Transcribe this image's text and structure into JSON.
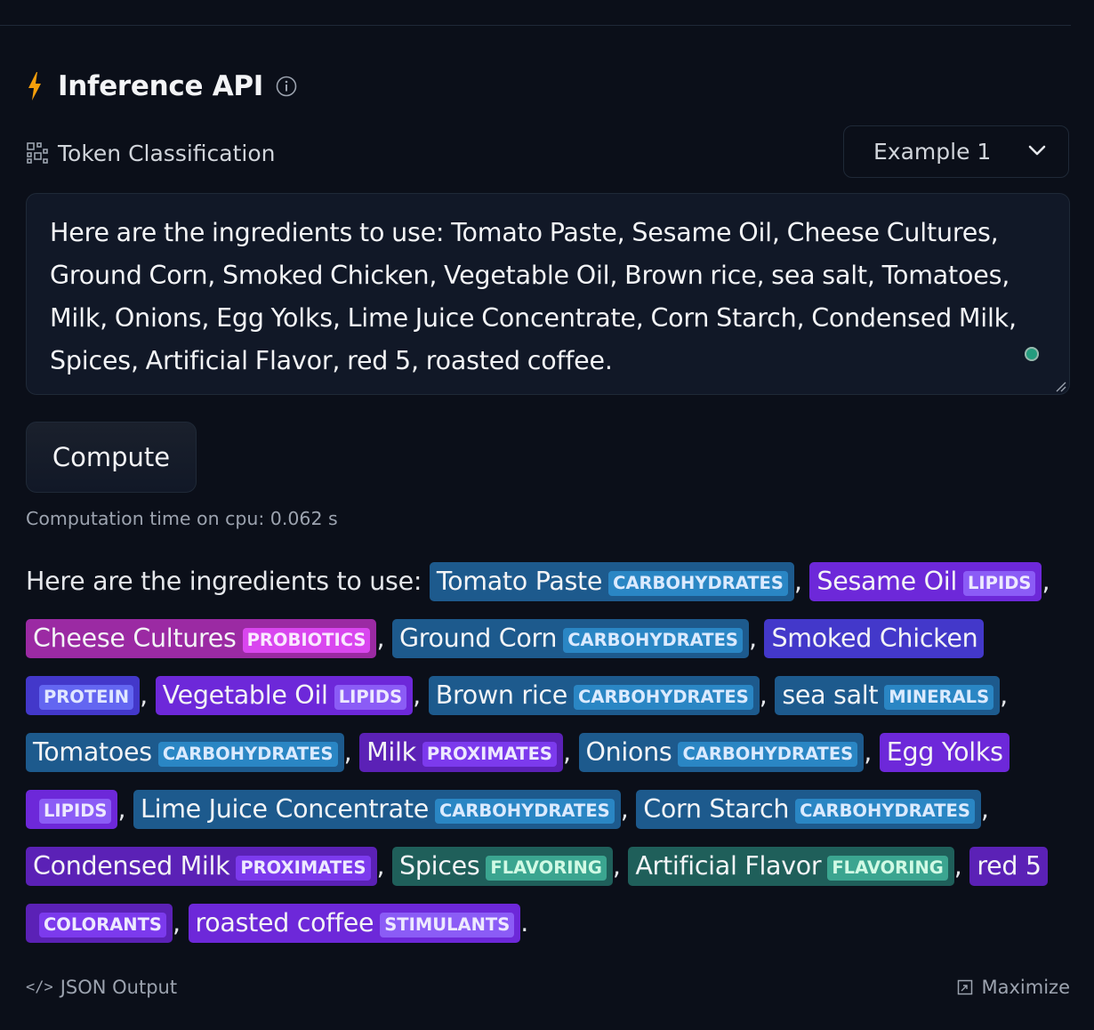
{
  "header": {
    "title": "Inference API"
  },
  "task": {
    "label": "Token Classification"
  },
  "example_select": {
    "selected": "Example 1"
  },
  "input": {
    "text": "Here are the ingredients to use: Tomato Paste, Sesame Oil, Cheese Cultures,  Ground Corn, Smoked Chicken, Vegetable Oil, Brown rice, sea salt, Tomatoes, Milk, Onions, Egg Yolks, Lime Juice Concentrate, Corn Starch, Condensed Milk, Spices, Artificial Flavor, red 5, roasted coffee."
  },
  "compute_button": {
    "label": "Compute"
  },
  "computation_time": "Computation time on cpu: 0.062 s",
  "output": {
    "prefix": "Here are the ingredients to use: ",
    "entities": [
      {
        "text": "Tomato Paste",
        "label": "CARBOHYDRATES",
        "sep": ", "
      },
      {
        "text": "Sesame Oil",
        "label": "LIPIDS",
        "sep": ", "
      },
      {
        "text": "Cheese Cultures",
        "label": "PROBIOTICS",
        "sep": ", "
      },
      {
        "text": "Ground Corn",
        "label": "CARBOHYDRATES",
        "sep": ", "
      },
      {
        "text": "Smoked Chicken",
        "label": "PROTEIN",
        "sep": ", "
      },
      {
        "text": "Vegetable Oil",
        "label": "LIPIDS",
        "sep": ", "
      },
      {
        "text": "Brown rice",
        "label": "CARBOHYDRATES",
        "sep": ", "
      },
      {
        "text": "sea salt",
        "label": "MINERALS",
        "sep": ", "
      },
      {
        "text": "Tomatoes",
        "label": "CARBOHYDRATES",
        "sep": ", "
      },
      {
        "text": "Milk",
        "label": "PROXIMATES",
        "sep": ", "
      },
      {
        "text": "Onions",
        "label": "CARBOHYDRATES",
        "sep": ", "
      },
      {
        "text": "Egg Yolks",
        "label": "LIPIDS",
        "sep": ", "
      },
      {
        "text": "Lime Juice Concentrate",
        "label": "CARBOHYDRATES",
        "sep": ", "
      },
      {
        "text": "Corn Starch",
        "label": "CARBOHYDRATES",
        "sep": ", "
      },
      {
        "text": "Condensed Milk",
        "label": "PROXIMATES",
        "sep": ", "
      },
      {
        "text": "Spices",
        "label": "FLAVORING",
        "sep": ", "
      },
      {
        "text": "Artificial Flavor",
        "label": "FLAVORING",
        "sep": ", "
      },
      {
        "text": "red 5",
        "label": "COLORANTS",
        "sep": ", "
      },
      {
        "text": "roasted coffee",
        "label": "STIMULANTS",
        "sep": "."
      }
    ]
  },
  "label_colors": {
    "CARBOHYDRATES": "#1d5a8d",
    "LIPIDS": "#6d28d9",
    "PROBIOTICS": "#9b2aa3",
    "PROTEIN": "#4338ca",
    "MINERALS": "#1d5a8d",
    "PROXIMATES": "#5b21b6",
    "FLAVORING": "#1f5f5a",
    "COLORANTS": "#5b21b6",
    "STIMULANTS": "#6d28d9"
  },
  "footer": {
    "json_output": "JSON Output",
    "maximize": "Maximize"
  },
  "icons": {
    "header": "lightning-bolt-icon",
    "info": "info-icon",
    "task": "token-classification-icon",
    "select": "chevron-down-icon",
    "json": "code-icon",
    "maximize": "maximize-icon"
  }
}
